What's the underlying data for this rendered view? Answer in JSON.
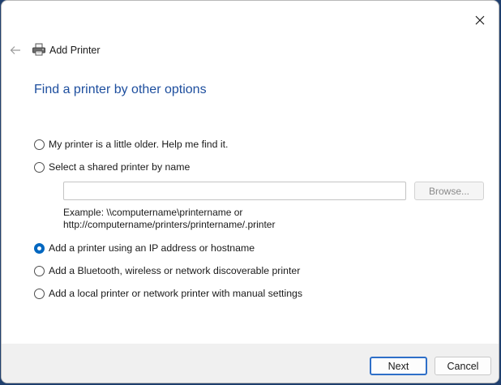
{
  "window": {
    "close_icon": "close-icon"
  },
  "header": {
    "back_icon": "back-arrow-icon",
    "printer_icon": "printer-icon",
    "title": "Add Printer"
  },
  "main": {
    "heading": "Find a printer by other options",
    "options": [
      {
        "label": "My printer is a little older. Help me find it.",
        "checked": false
      },
      {
        "label": "Select a shared printer by name",
        "checked": false
      },
      {
        "label": "Add a printer using an IP address or hostname",
        "checked": true
      },
      {
        "label": "Add a Bluetooth, wireless or network discoverable printer",
        "checked": false
      },
      {
        "label": "Add a local printer or network printer with manual settings",
        "checked": false
      }
    ],
    "shared_printer": {
      "value": "",
      "placeholder": "",
      "browse_label": "Browse...",
      "example_line1": "Example: \\\\computername\\printername or",
      "example_line2": "http://computername/printers/printername/.printer"
    }
  },
  "footer": {
    "next_label": "Next",
    "cancel_label": "Cancel"
  },
  "colors": {
    "accent": "#0067c0",
    "heading": "#1d4e9e",
    "footer_bg": "#f0f0f0",
    "desktop_bg": "#1f3f6e"
  }
}
